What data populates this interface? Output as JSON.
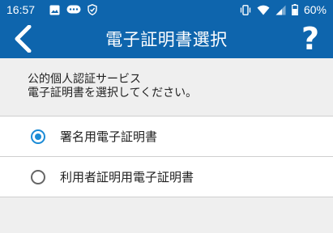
{
  "status_bar": {
    "time": "16:57",
    "battery": "60%",
    "left_icons": [
      "image-icon",
      "chat-icon",
      "shield-check-icon"
    ],
    "right_icons": [
      "vibrate-icon",
      "wifi-icon",
      "signal-icon",
      "battery-icon"
    ]
  },
  "app_bar": {
    "title": "電子証明書選択",
    "help_label": "?",
    "color": "#0e65ad"
  },
  "description": {
    "line1": "公的個人認証サービス",
    "line2": "電子証明書を選択してください。"
  },
  "options": [
    {
      "label": "署名用電子証明書",
      "checked": true
    },
    {
      "label": "利用者証明用電子証明書",
      "checked": false
    }
  ]
}
